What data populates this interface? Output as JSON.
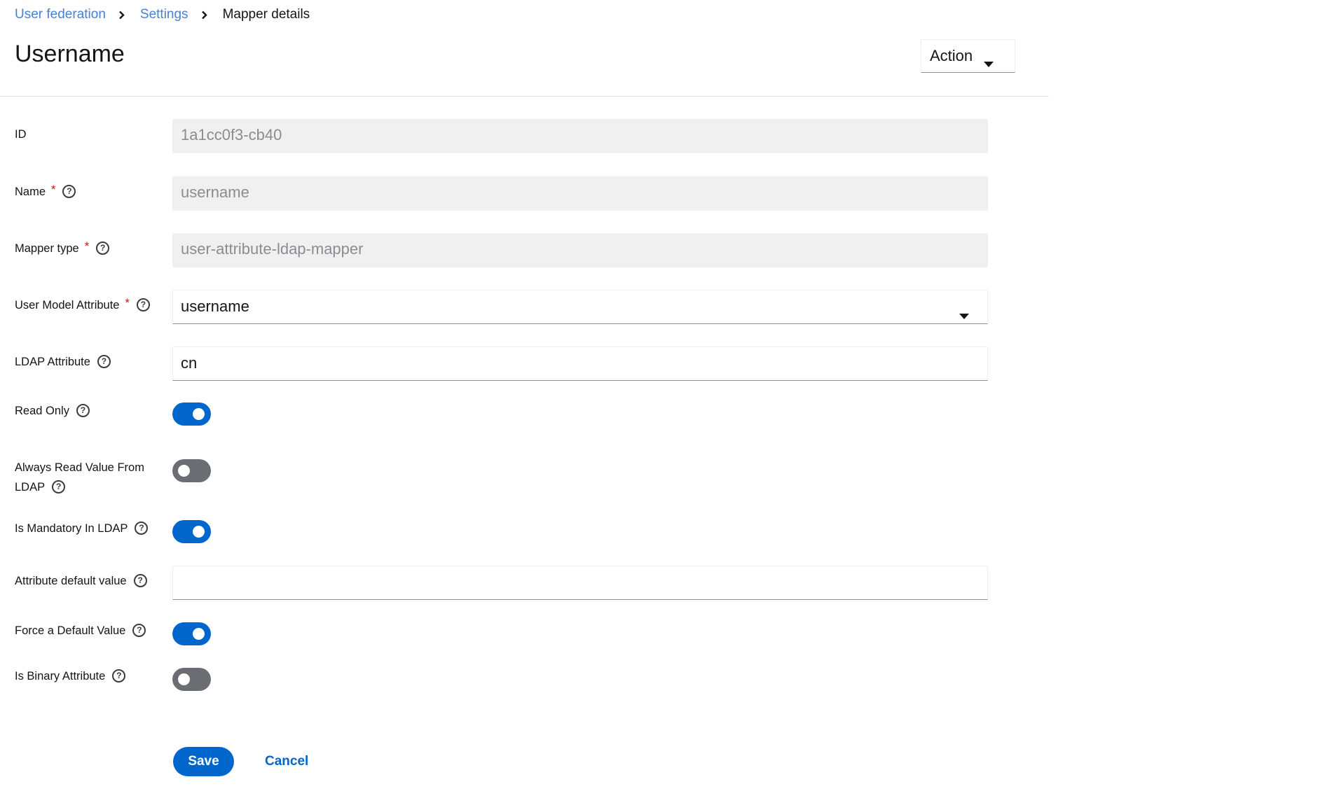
{
  "breadcrumb": {
    "items": [
      "User federation",
      "Settings"
    ],
    "current": "Mapper details"
  },
  "header": {
    "title": "Username",
    "action_label": "Action"
  },
  "form": {
    "id": {
      "label": "ID",
      "value": "1a1cc0f3-cb40"
    },
    "name": {
      "label": "Name",
      "value": "username",
      "required": true
    },
    "mapper_type": {
      "label": "Mapper type",
      "value": "user-attribute-ldap-mapper",
      "required": true
    },
    "user_model_attribute": {
      "label": "User Model Attribute",
      "value": "username",
      "required": true
    },
    "ldap_attribute": {
      "label": "LDAP Attribute",
      "value": "cn"
    },
    "read_only": {
      "label": "Read Only",
      "on": true
    },
    "always_read": {
      "label_line1": "Always Read Value From",
      "label_line2": "LDAP",
      "on": false
    },
    "is_mandatory": {
      "label": "Is Mandatory In LDAP",
      "on": true
    },
    "attribute_default": {
      "label": "Attribute default value",
      "value": ""
    },
    "force_default": {
      "label": "Force a Default Value",
      "on": true
    },
    "is_binary": {
      "label": "Is Binary Attribute",
      "on": false
    },
    "required_marker": "*",
    "help_glyph": "?"
  },
  "buttons": {
    "save": "Save",
    "cancel": "Cancel"
  },
  "colors": {
    "primary": "#0066cc",
    "link": "#4b7fd0",
    "required": "#c9190b",
    "toggle_off": "#6a6e73",
    "disabled_bg": "#f0f0f0"
  },
  "icons": {
    "breadcrumb_separator": "chevron-right-icon",
    "dropdown": "caret-down-icon",
    "help": "help-icon"
  }
}
